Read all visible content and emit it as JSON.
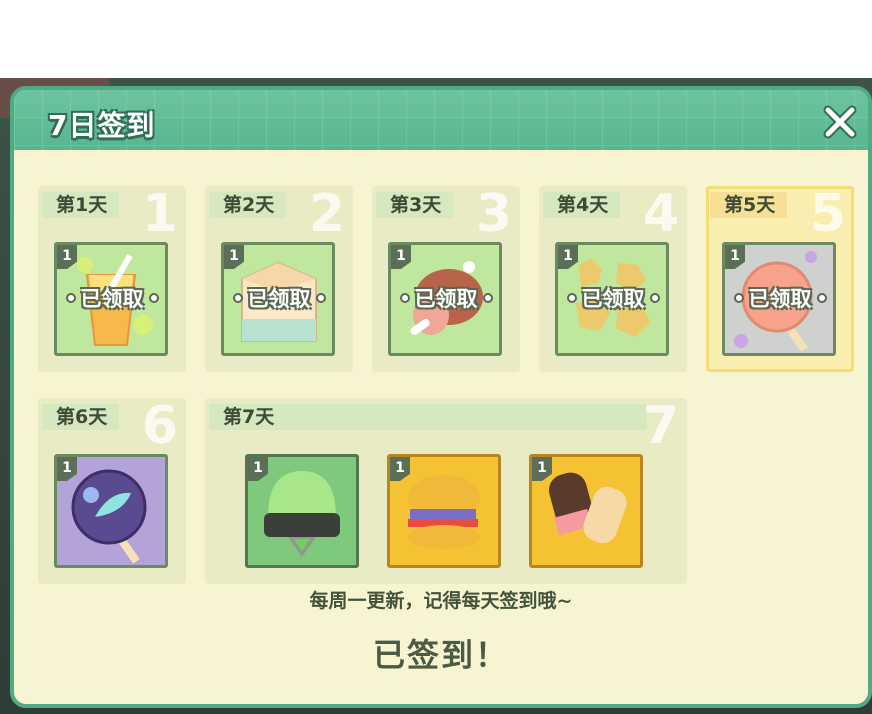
{
  "dialog": {
    "title": "7日签到",
    "close_icon": "close-x-icon"
  },
  "days": [
    {
      "label": "第1天",
      "num": "1",
      "qty": "1",
      "claimed_text": "已领取",
      "item": "juice-cup-icon"
    },
    {
      "label": "第2天",
      "num": "2",
      "qty": "1",
      "claimed_text": "已领取",
      "item": "milk-carton-icon"
    },
    {
      "label": "第3天",
      "num": "3",
      "qty": "1",
      "claimed_text": "已领取",
      "item": "meat-leg-icon"
    },
    {
      "label": "第4天",
      "num": "4",
      "qty": "1",
      "claimed_text": "已领取",
      "item": "cookies-icon"
    },
    {
      "label": "第5天",
      "num": "5",
      "qty": "1",
      "claimed_text": "已领取",
      "item": "lollipop-icon"
    },
    {
      "label": "第6天",
      "num": "6",
      "qty": "1",
      "item": "purple-lollipop-icon"
    },
    {
      "label": "第7天",
      "num": "7",
      "rewards": [
        {
          "qty": "1",
          "item": "green-capsule-icon"
        },
        {
          "qty": "1",
          "item": "burger-icon"
        },
        {
          "qty": "1",
          "item": "popsicle-icon"
        }
      ]
    }
  ],
  "footer": {
    "note": "每周一更新，记得每天签到哦~",
    "status": "已签到！"
  },
  "colors": {
    "header": "#58b58d",
    "panel": "#f7f4d2",
    "selected_border": "#f5dd73"
  }
}
